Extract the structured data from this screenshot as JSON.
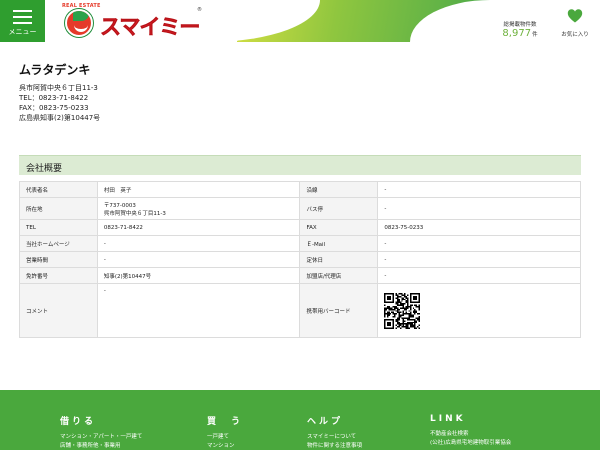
{
  "header": {
    "menu_label": "メニュー",
    "logo_tag": "REAL ESTATE",
    "logo_text": "スマイミー",
    "logo_reg": "®",
    "count_label": "総掲載物件数",
    "count_value": "8,977",
    "count_unit": "件",
    "favorites_label": "お気に入り",
    "accent_color": "#2f9e2f"
  },
  "company": {
    "name": "ムラタデンキ",
    "address": "呉市阿賀中央６丁目11-3",
    "tel": "TEL：0823-71-8422",
    "fax": "FAX：0823-75-0233",
    "license": "広島県知事(2)第10447号"
  },
  "section": {
    "title": "会社概要"
  },
  "overview": {
    "r1": {
      "k1": "代表者名",
      "v1": "村田　英子",
      "k2": "沿線",
      "v2": "-"
    },
    "r2": {
      "k1": "所在地",
      "v1a": "〒737-0003",
      "v1b": "呉市阿賀中央６丁目11-3",
      "k2": "バス停",
      "v2": "-"
    },
    "r3": {
      "k1": "TEL",
      "v1": "0823-71-8422",
      "k2": "FAX",
      "v2": "0823-75-0233"
    },
    "r4": {
      "k1": "当社ホームページ",
      "v1": "-",
      "k2": "Ｅ-Mail",
      "v2": "-"
    },
    "r5": {
      "k1": "営業時間",
      "v1": "-",
      "k2": "定休日",
      "v2": "-"
    },
    "r6": {
      "k1": "免許番号",
      "v1": "知事(2)第10447号",
      "k2": "加盟店/代理店",
      "v2": "-"
    },
    "r7": {
      "k1": "コメント",
      "v1": "-",
      "k2": "携帯用バーコード"
    }
  },
  "footer": {
    "rent": {
      "title": "借りる",
      "l1": "マンション・アパート・一戸建て",
      "l2": "店舗・事務所他・事業用"
    },
    "buy": {
      "title": "買　う",
      "l1": "一戸建て",
      "l2": "マンション"
    },
    "help": {
      "title": "ヘルプ",
      "l1": "スマイミーについて",
      "l2": "物件に関する注意事項"
    },
    "link": {
      "title": "LINK",
      "l1": "不動産会社検索",
      "l2": "(公社)広島県宅地建物取引業協会"
    }
  }
}
